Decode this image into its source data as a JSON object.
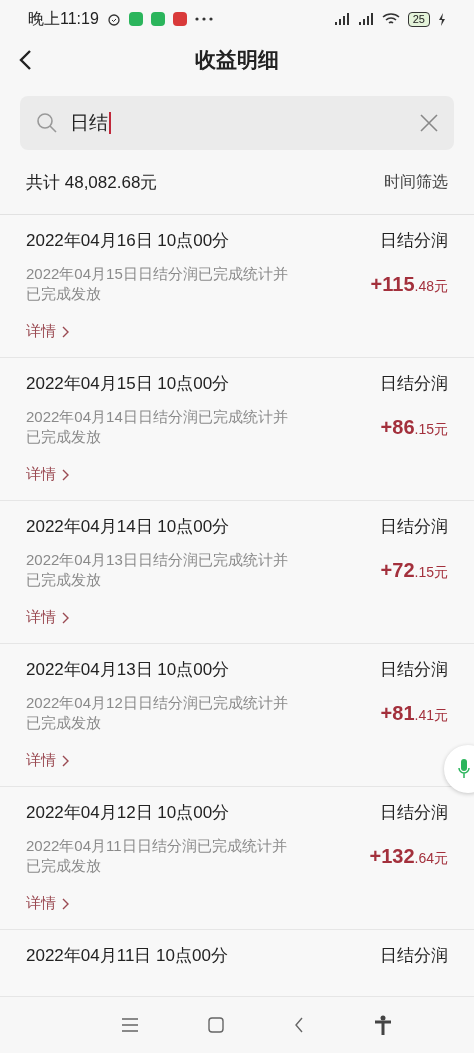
{
  "status_bar": {
    "time": "晚上11:19",
    "battery": "25"
  },
  "header": {
    "title": "收益明细"
  },
  "search": {
    "value": "日结"
  },
  "summary": {
    "total": "共计 48,082.68元",
    "filter": "时间筛选"
  },
  "records": [
    {
      "datetime": "2022年04月16日 10点00分",
      "type": "日结分润",
      "description": "2022年04月15日日结分润已完成统计并已完成发放",
      "amount_main": "+115",
      "amount_fraction": ".48元",
      "details": "详情"
    },
    {
      "datetime": "2022年04月15日 10点00分",
      "type": "日结分润",
      "description": "2022年04月14日日结分润已完成统计并已完成发放",
      "amount_main": "+86",
      "amount_fraction": ".15元",
      "details": "详情"
    },
    {
      "datetime": "2022年04月14日 10点00分",
      "type": "日结分润",
      "description": "2022年04月13日日结分润已完成统计并已完成发放",
      "amount_main": "+72",
      "amount_fraction": ".15元",
      "details": "详情"
    },
    {
      "datetime": "2022年04月13日 10点00分",
      "type": "日结分润",
      "description": "2022年04月12日日结分润已完成统计并已完成发放",
      "amount_main": "+81",
      "amount_fraction": ".41元",
      "details": "详情"
    },
    {
      "datetime": "2022年04月12日 10点00分",
      "type": "日结分润",
      "description": "2022年04月11日日结分润已完成统计并已完成发放",
      "amount_main": "+132",
      "amount_fraction": ".64元",
      "details": "详情"
    },
    {
      "datetime": "2022年04月11日 10点00分",
      "type": "日结分润"
    }
  ]
}
